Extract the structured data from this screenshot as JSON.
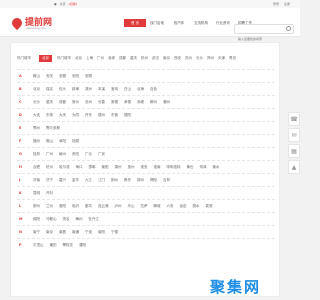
{
  "topbar": {
    "location": "北京",
    "change": "[切换]",
    "login": "登录",
    "register": "注册"
  },
  "brand": {
    "name": "提前网",
    "domain": "jiqianwang.com"
  },
  "nav": {
    "items": [
      {
        "label": "首 页"
      },
      {
        "label": "找门店电"
      },
      {
        "label": "找汽车"
      },
      {
        "label": "交流机构"
      },
      {
        "label": "行业资讯"
      },
      {
        "label": "招聘工作"
      }
    ]
  },
  "search": {
    "placeholder": "输入您要找的商家"
  },
  "filter": {
    "label": "热门城市",
    "active": "北京",
    "links": [
      "热门城市",
      "北京",
      "上海",
      "广州",
      "深圳",
      "成都",
      "重庆",
      "杭州",
      "武汉",
      "南京",
      "西安",
      "苏州",
      "长沙",
      "郑州",
      "天津",
      "青岛"
    ]
  },
  "provinces": [
    {
      "code": "A",
      "cities": [
        "鞍山",
        "安庆",
        "安徽",
        "安阳",
        "安顺"
      ]
    },
    {
      "code": "B",
      "cities": [
        "北京",
        "保定",
        "包头",
        "蚌埠",
        "滨州",
        "本溪",
        "宝鸡",
        "白山",
        "北海",
        "百色"
      ]
    },
    {
      "code": "C",
      "cities": [
        "长沙",
        "重庆",
        "成都",
        "常州",
        "沧州",
        "长春",
        "常德",
        "承德",
        "赤峰",
        "郴州",
        "潮州"
      ]
    },
    {
      "code": "D",
      "cities": [
        "大连",
        "东莞",
        "大庆",
        "大同",
        "丹东",
        "德州",
        "东营",
        "德阳"
      ]
    },
    {
      "code": "E",
      "cities": [
        "鄂州",
        "鄂尔多斯"
      ]
    },
    {
      "code": "F",
      "cities": [
        "福州",
        "佛山",
        "阜阳",
        "抚顺"
      ]
    },
    {
      "code": "G",
      "cities": [
        "桂林",
        "广州",
        "赣州",
        "贵阳",
        "广元",
        "广安"
      ]
    },
    {
      "code": "H",
      "cities": [
        "合肥",
        "杭州",
        "哈尔滨",
        "海口",
        "邯郸",
        "衡阳",
        "湖州",
        "惠州",
        "淮安",
        "淮南",
        "呼和浩特",
        "黄石",
        "菏泽",
        "衡水"
      ]
    },
    {
      "code": "J",
      "cities": [
        "济南",
        "济宁",
        "嘉兴",
        "金华",
        "九江",
        "江门",
        "荆州",
        "焦作",
        "锦州",
        "揭阳",
        "吉林"
      ]
    },
    {
      "code": "K",
      "cities": [
        "昆明",
        "开封"
      ]
    },
    {
      "code": "L",
      "cities": [
        "柳州",
        "兰州",
        "洛阳",
        "临沂",
        "廊坊",
        "连云港",
        "泸州",
        "乐山",
        "拉萨",
        "聊城",
        "六安",
        "龙岩",
        "丽水",
        "娄底"
      ]
    },
    {
      "code": "M",
      "cities": [
        "绵阳",
        "马鞍山",
        "茂名",
        "梅州",
        "牡丹江"
      ]
    },
    {
      "code": "N",
      "cities": [
        "南宁",
        "南京",
        "南昌",
        "南通",
        "宁波",
        "南阳",
        "宁德"
      ]
    },
    {
      "code": "P",
      "cities": [
        "平顶山",
        "莆田",
        "攀枝花",
        "濮阳"
      ]
    }
  ],
  "float_bar": {
    "items": [
      "phone-icon",
      "chat-icon",
      "qr-icon",
      "top-icon"
    ]
  },
  "watermark": {
    "text": "聚集网"
  },
  "colors": {
    "accent": "#e03a3a",
    "watermark": "#1f8ee5"
  }
}
